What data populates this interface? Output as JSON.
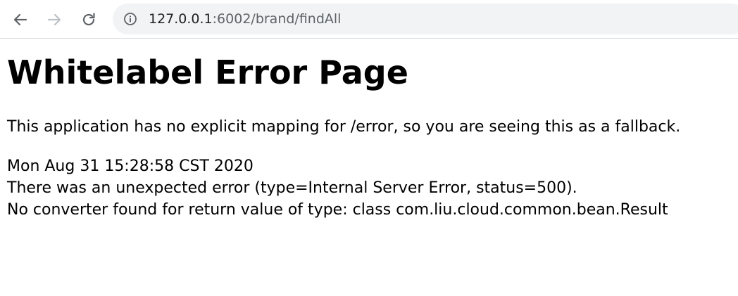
{
  "browser": {
    "url_host": "127.0.0.1",
    "url_rest": ":6002/brand/findAll",
    "icons": {
      "back": "arrow-left-icon",
      "forward": "arrow-right-icon",
      "reload": "reload-icon",
      "site_info": "info-circle-icon"
    },
    "colors": {
      "omnibox_bg": "#f1f3f4",
      "icon_active": "#5f6368",
      "icon_disabled": "#bdc1c6"
    }
  },
  "page": {
    "title": "Whitelabel Error Page",
    "fallback_message": "This application has no explicit mapping for /error, so you are seeing this as a fallback.",
    "timestamp": "Mon Aug 31 15:28:58 CST 2020",
    "error_summary": "There was an unexpected error (type=Internal Server Error, status=500).",
    "error_detail": "No converter found for return value of type: class com.liu.cloud.common.bean.Result"
  }
}
